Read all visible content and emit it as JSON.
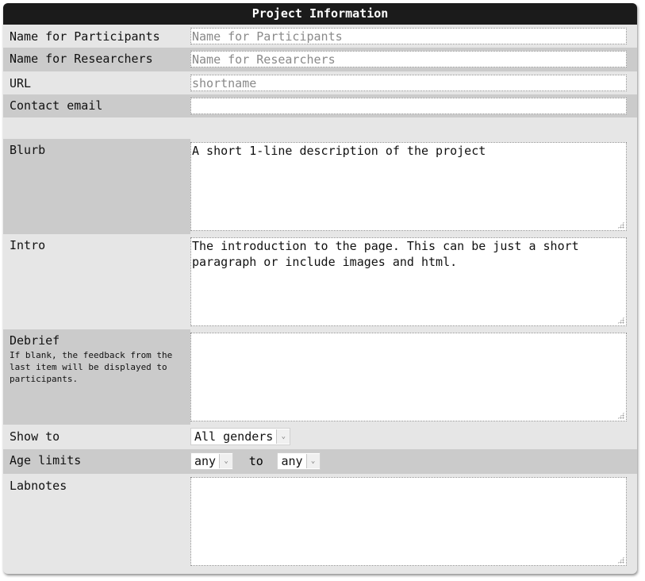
{
  "panel": {
    "title": "Project Information"
  },
  "fields": {
    "name_participants": {
      "label": "Name for Participants",
      "placeholder": "Name for Participants",
      "value": ""
    },
    "name_researchers": {
      "label": "Name for Researchers",
      "placeholder": "Name for Researchers",
      "value": ""
    },
    "url": {
      "label": "URL",
      "placeholder": "shortname",
      "value": ""
    },
    "contact_email": {
      "label": "Contact email",
      "placeholder": "",
      "value": ""
    },
    "blurb": {
      "label": "Blurb",
      "value": "A short 1-line description of the project"
    },
    "intro": {
      "label": "Intro",
      "value": "The introduction to the page. This can be just a short paragraph or include images and html."
    },
    "debrief": {
      "label": "Debrief",
      "note": "If blank, the feedback from the last item will be displayed to participants.",
      "value": ""
    },
    "show_to": {
      "label": "Show to",
      "selected": "All genders"
    },
    "age_limits": {
      "label": "Age limits",
      "min_selected": "any",
      "separator": "to",
      "max_selected": "any"
    },
    "labnotes": {
      "label": "Labnotes",
      "value": ""
    }
  },
  "icons": {
    "select_arrow": "chevron-down-icon",
    "resize_grip": "resize-grip-icon"
  }
}
